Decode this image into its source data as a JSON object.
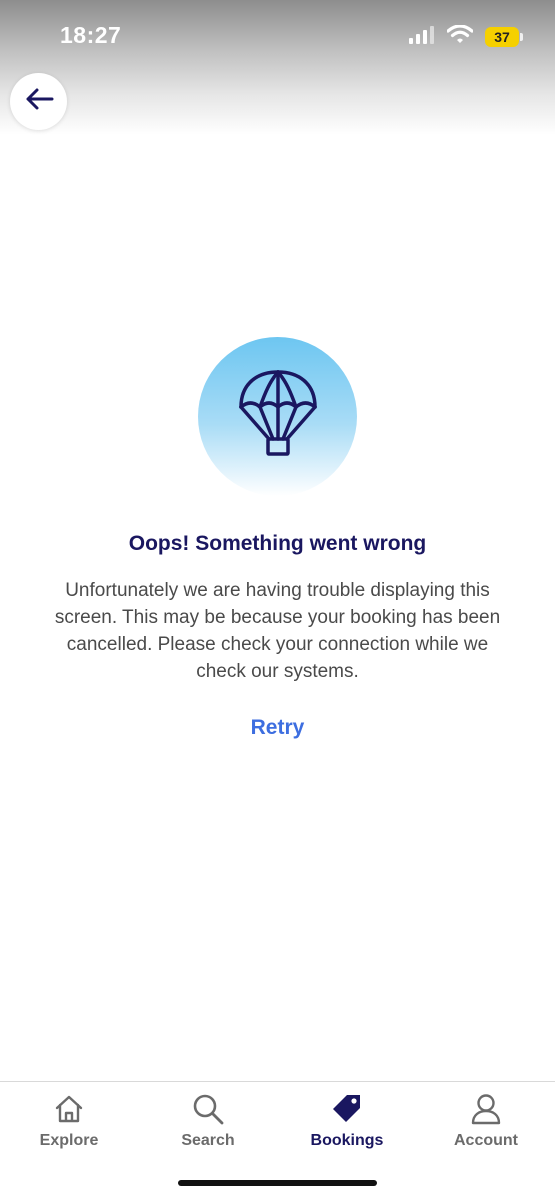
{
  "status_bar": {
    "time": "18:27",
    "battery_level": "37",
    "icons": [
      "signal-icon",
      "wifi-icon",
      "battery-icon"
    ]
  },
  "header": {
    "back_icon": "arrow-left-icon"
  },
  "error": {
    "illustration_icon": "parachute-icon",
    "title": "Oops! Something went wrong",
    "message": "Unfortunately we are having trouble displaying this screen. This may be because your booking has been cancelled. Please check your connection while we check our systems.",
    "retry_label": "Retry"
  },
  "bottom_nav": {
    "active": "Bookings",
    "items": [
      {
        "label": "Explore",
        "icon": "home-icon"
      },
      {
        "label": "Search",
        "icon": "search-icon"
      },
      {
        "label": "Bookings",
        "icon": "tag-icon"
      },
      {
        "label": "Account",
        "icon": "user-icon"
      }
    ]
  },
  "colors": {
    "brand_navy": "#1a1760",
    "link_blue": "#3d6ee0",
    "battery_yellow": "#f5d000",
    "illustration_blue": "#6dc6f1"
  }
}
